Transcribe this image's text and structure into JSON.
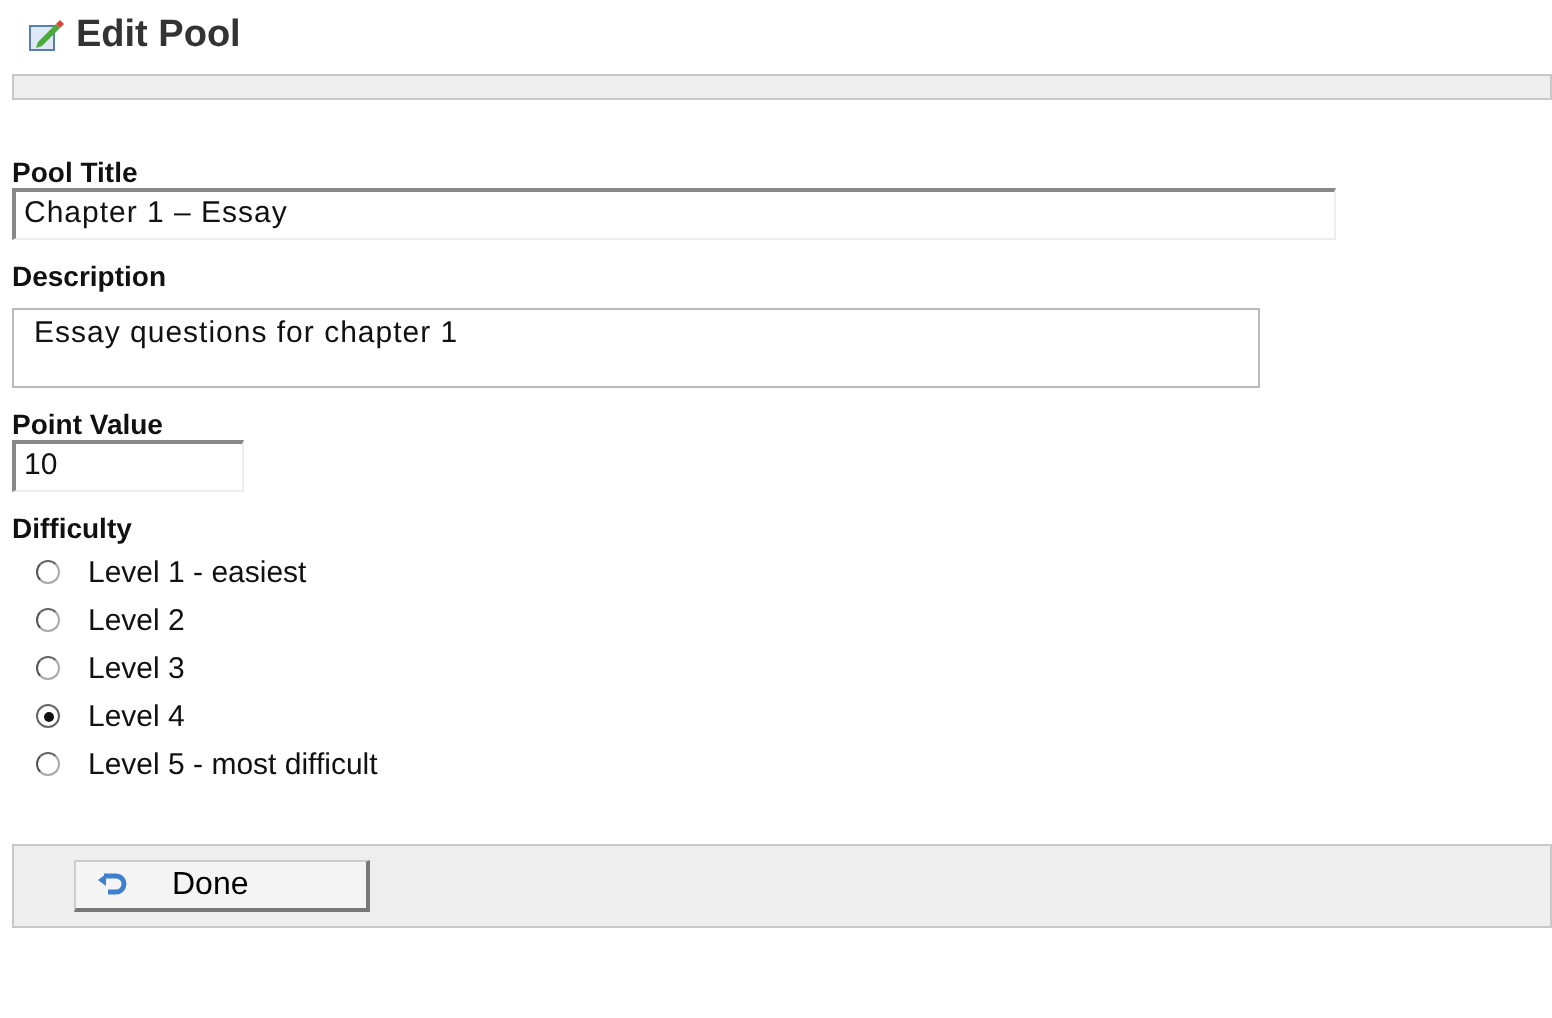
{
  "page_title": "Edit Pool",
  "fields": [
    {
      "label": "Pool Title",
      "value": "Chapter 1 – Essay",
      "kind": "title"
    },
    {
      "label": "Description",
      "value": "Essay questions for chapter 1",
      "kind": "textarea"
    },
    {
      "label": "Point Value",
      "value": "10",
      "kind": "short"
    }
  ],
  "difficulty": {
    "label": "Difficulty",
    "options": [
      {
        "label": "Level 1 - easiest",
        "selected": false
      },
      {
        "label": "Level 2",
        "selected": false
      },
      {
        "label": "Level 3",
        "selected": false
      },
      {
        "label": "Level 4",
        "selected": true
      },
      {
        "label": "Level 5 - most difficult",
        "selected": false
      }
    ]
  },
  "done_button": "Done"
}
